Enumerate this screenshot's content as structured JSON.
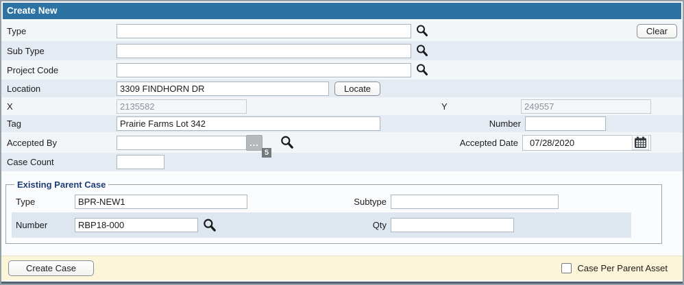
{
  "window": {
    "title": "Create New"
  },
  "buttons": {
    "clear": "Clear",
    "locate": "Locate",
    "create_case": "Create Case"
  },
  "fields": {
    "type": {
      "label": "Type",
      "value": ""
    },
    "sub_type": {
      "label": "Sub Type",
      "value": ""
    },
    "project_code": {
      "label": "Project Code",
      "value": ""
    },
    "location": {
      "label": "Location",
      "value": "3309 FINDHORN DR"
    },
    "x": {
      "label": "X",
      "value": "2135582",
      "disabled": true
    },
    "y": {
      "label": "Y",
      "value": "249557",
      "disabled": true
    },
    "tag": {
      "label": "Tag",
      "value": "Prairie Farms Lot 342"
    },
    "number": {
      "label": "Number",
      "value": ""
    },
    "accepted_by": {
      "label": "Accepted By",
      "value": "",
      "ellipsis": "...",
      "badge": "5"
    },
    "accepted_date": {
      "label": "Accepted Date",
      "value": "07/28/2020"
    },
    "case_count": {
      "label": "Case Count",
      "value": ""
    }
  },
  "parent_case": {
    "legend": "Existing Parent Case",
    "type": {
      "label": "Type",
      "value": "BPR-NEW1"
    },
    "subtype": {
      "label": "Subtype",
      "value": ""
    },
    "number": {
      "label": "Number",
      "value": "RBP18-000"
    },
    "qty": {
      "label": "Qty",
      "value": ""
    }
  },
  "footer": {
    "checkbox_label": "Case Per Parent Asset",
    "checkbox_checked": false
  },
  "icons": {
    "search": "magnifier",
    "calendar": "calendar-grid",
    "ellipsis": "lookup-dots"
  },
  "colors": {
    "header_blue": "#2c73a3",
    "row_light": "#f2f6f9",
    "row_dark": "#e4ebf2",
    "parent_band_blue": "#dee6f0",
    "footer_cream": "#fcf5da",
    "legend_navy": "#1f3d77",
    "window_border": "#93a0a8",
    "bottom_strip": "#52626c"
  }
}
